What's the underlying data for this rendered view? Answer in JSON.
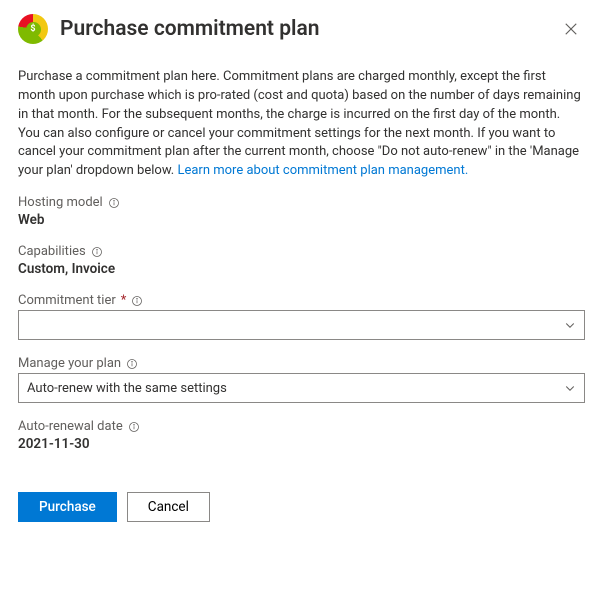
{
  "header": {
    "title": "Purchase commitment plan"
  },
  "description": {
    "text": "Purchase a commitment plan here. Commitment plans are charged monthly, except the first month upon purchase which is pro-rated (cost and quota) based on the number of days remaining in that month. For the subsequent months, the charge is incurred on the first day of the month. You can also configure or cancel your commitment settings for the next month. If you want to cancel your commitment plan after the current month, choose \"Do not auto-renew\" in the 'Manage your plan' dropdown below. ",
    "link": "Learn more about commitment plan management."
  },
  "fields": {
    "hosting_model": {
      "label": "Hosting model",
      "value": "Web"
    },
    "capabilities": {
      "label": "Capabilities",
      "value": "Custom, Invoice"
    },
    "commitment_tier": {
      "label": "Commitment tier",
      "value": ""
    },
    "manage_plan": {
      "label": "Manage your plan",
      "value": "Auto-renew with the same settings"
    },
    "auto_renew_date": {
      "label": "Auto-renewal date",
      "value": "2021-11-30"
    }
  },
  "footer": {
    "purchase": "Purchase",
    "cancel": "Cancel"
  }
}
